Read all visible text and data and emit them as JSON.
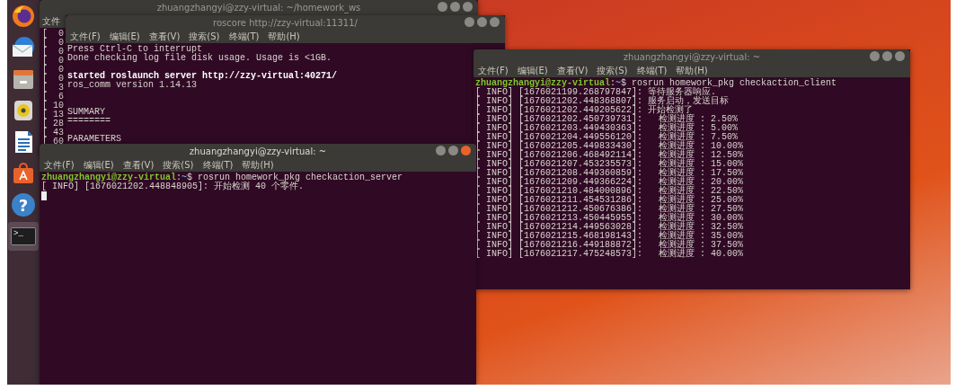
{
  "dock": [
    {
      "kind": "browser",
      "selected": false
    },
    {
      "kind": "mail",
      "selected": false
    },
    {
      "kind": "files",
      "selected": false
    },
    {
      "kind": "music",
      "selected": false
    },
    {
      "kind": "writer",
      "selected": false
    },
    {
      "kind": "software",
      "selected": false
    },
    {
      "kind": "help",
      "glyph": "?",
      "selected": false
    },
    {
      "kind": "terminal",
      "glyph": ">_",
      "selected": true
    }
  ],
  "windows": [
    {
      "title": "zhuangzhangyi@zzy-virtual: ~/homework_ws",
      "active": false,
      "menu": [
        "文件"
      ],
      "lines": [
        {
          "kind": "text",
          "text": "[  0"
        },
        {
          "kind": "text",
          "text": "[  0"
        },
        {
          "kind": "text",
          "text": "[  0"
        },
        {
          "kind": "text",
          "text": "[  0"
        },
        {
          "kind": "text",
          "text": "[  0"
        },
        {
          "kind": "text",
          "text": "[  0"
        },
        {
          "kind": "text",
          "text": "[  3"
        },
        {
          "kind": "text",
          "text": "[  6"
        },
        {
          "kind": "text",
          "text": "[ 10"
        },
        {
          "kind": "text",
          "text": "[ 13"
        },
        {
          "kind": "text",
          "text": "[ 28"
        },
        {
          "kind": "text",
          "text": "[ 43"
        },
        {
          "kind": "text",
          "text": "[ 60"
        }
      ]
    },
    {
      "title": "roscore http://zzy-virtual:11311/",
      "active": false,
      "menu": [
        "文件(F)",
        "编辑(E)",
        "查看(V)",
        "搜索(S)",
        "终端(T)",
        "帮助(H)"
      ],
      "lines": [
        {
          "kind": "text",
          "text": "Press Ctrl-C to interrupt"
        },
        {
          "kind": "text",
          "text": "Done checking log file disk usage. Usage is <1GB."
        },
        {
          "kind": "blank"
        },
        {
          "kind": "text",
          "text": "started roslaunch server http://zzy-virtual:40271/",
          "bold": true
        },
        {
          "kind": "text",
          "text": "ros_comm version 1.14.13"
        },
        {
          "kind": "blank"
        },
        {
          "kind": "blank"
        },
        {
          "kind": "text",
          "text": "SUMMARY"
        },
        {
          "kind": "text",
          "text": "========"
        },
        {
          "kind": "blank"
        },
        {
          "kind": "text",
          "text": "PARAMETERS"
        }
      ]
    },
    {
      "title": "zhuangzhangyi@zzy-virtual: ~",
      "active": false,
      "menu": [
        "文件(F)",
        "编辑(E)",
        "查看(V)",
        "搜索(S)",
        "终端(T)",
        "帮助(H)"
      ],
      "lines": [
        {
          "kind": "prompt",
          "user": "zhuangzhangyi@zzy-virtual",
          "separator": ":",
          "path": "~",
          "symbol": "$",
          "command": "rosrun homework_pkg checkaction_client"
        },
        {
          "kind": "text",
          "text": "[ INFO] [1676021199.268797847]: 等待服务器响应."
        },
        {
          "kind": "text",
          "text": "[ INFO] [1676021202.448368807]: 服务启动，发送目标"
        },
        {
          "kind": "text",
          "text": "[ INFO] [1676021202.449205622]: 开始检测了"
        },
        {
          "kind": "text",
          "text": "[ INFO] [1676021202.450739731]:   检测进度 : 2.50%"
        },
        {
          "kind": "text",
          "text": "[ INFO] [1676021203.449430363]:   检测进度 : 5.00%"
        },
        {
          "kind": "text",
          "text": "[ INFO] [1676021204.449556120]:   检测进度 : 7.50%"
        },
        {
          "kind": "text",
          "text": "[ INFO] [1676021205.449833430]:   检测进度 : 10.00%"
        },
        {
          "kind": "text",
          "text": "[ INFO] [1676021206.468492114]:   检测进度 : 12.50%"
        },
        {
          "kind": "text",
          "text": "[ INFO] [1676021207.453235573]:   检测进度 : 15.00%"
        },
        {
          "kind": "text",
          "text": "[ INFO] [1676021208.449360859]:   检测进度 : 17.50%"
        },
        {
          "kind": "text",
          "text": "[ INFO] [1676021209.449366224]:   检测进度 : 20.00%"
        },
        {
          "kind": "text",
          "text": "[ INFO] [1676021210.484000896]:   检测进度 : 22.50%"
        },
        {
          "kind": "text",
          "text": "[ INFO] [1676021211.454531286]:   检测进度 : 25.00%"
        },
        {
          "kind": "text",
          "text": "[ INFO] [1676021212.450676386]:   检测进度 : 27.50%"
        },
        {
          "kind": "text",
          "text": "[ INFO] [1676021213.450445955]:   检测进度 : 30.00%"
        },
        {
          "kind": "text",
          "text": "[ INFO] [1676021214.449563028]:   检测进度 : 32.50%"
        },
        {
          "kind": "text",
          "text": "[ INFO] [1676021215.468198143]:   检测进度 : 35.00%"
        },
        {
          "kind": "text",
          "text": "[ INFO] [1676021216.449188872]:   检测进度 : 37.50%"
        },
        {
          "kind": "text",
          "text": "[ INFO] [1676021217.475248573]:   检测进度 : 40.00%"
        }
      ]
    },
    {
      "title": "zhuangzhangyi@zzy-virtual: ~",
      "active": true,
      "menu": [
        "文件(F)",
        "编辑(E)",
        "查看(V)",
        "搜索(S)",
        "终端(T)",
        "帮助(H)"
      ],
      "lines": [
        {
          "kind": "prompt",
          "user": "zhuangzhangyi@zzy-virtual",
          "separator": ":",
          "path": "~",
          "symbol": "$",
          "command": "rosrun homework_pkg checkaction_server"
        },
        {
          "kind": "text",
          "text": "[ INFO] [1676021202.448848905]: 开始检测 40 个零件."
        },
        {
          "kind": "cursor"
        }
      ]
    }
  ]
}
